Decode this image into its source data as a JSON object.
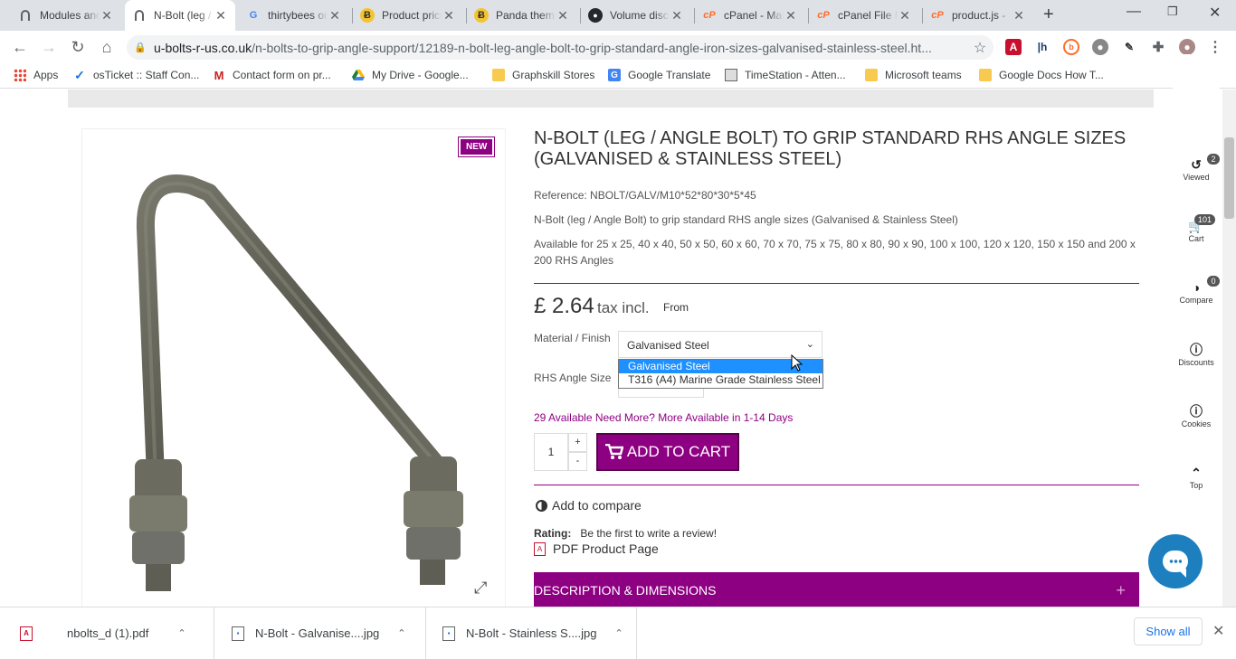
{
  "browser": {
    "tabs": [
      {
        "title": "Modules and Services",
        "favicon": "magnet-icon"
      },
      {
        "title": "N-Bolt (leg / Angle Bolt)",
        "favicon": "magnet-icon",
        "active": true
      },
      {
        "title": "thirtybees on",
        "favicon": "google-icon"
      },
      {
        "title": "Product price",
        "favicon": "bee-icon"
      },
      {
        "title": "Panda theme",
        "favicon": "bee-icon"
      },
      {
        "title": "Volume discounts",
        "favicon": "github-icon"
      },
      {
        "title": "cPanel - Main",
        "favicon": "cpanel-icon"
      },
      {
        "title": "cPanel File Manager",
        "favicon": "cpanel-icon"
      },
      {
        "title": "product.js - ",
        "favicon": "cpanel-icon"
      }
    ],
    "new_tab": "+",
    "url_domain": "u-bolts-r-us.co.uk",
    "url_path": "/n-bolts-to-grip-angle-support/12189-n-bolt-leg-angle-bolt-to-grip-standard-angle-iron-sizes-galvanised-stainless-steel.ht...",
    "bookmarks": [
      {
        "label": "Apps",
        "icon": "apps-grid-icon"
      },
      {
        "label": "osTicket :: Staff Con...",
        "icon": "check-icon"
      },
      {
        "label": "Contact form on pr...",
        "icon": "gmail-icon"
      },
      {
        "label": "My Drive - Google...",
        "icon": "drive-icon"
      },
      {
        "label": "Graphskill Stores",
        "icon": "folder-icon"
      },
      {
        "label": "Google Translate",
        "icon": "translate-icon"
      },
      {
        "label": "TimeStation - Atten...",
        "icon": "timestation-icon"
      },
      {
        "label": "Microsoft teams",
        "icon": "folder-icon"
      },
      {
        "label": "Google Docs How T...",
        "icon": "folder-icon"
      }
    ],
    "bookmarks_more": "»"
  },
  "product": {
    "badge": "NEW",
    "title": "N-Bolt (leg / Angle Bolt) to grip standard RHS angle sizes (Galvanised & Stainless Steel)",
    "reference": "Reference: NBOLT/GALV/M10*52*80*30*5*45",
    "short_desc": "N-Bolt (leg / Angle Bolt) to grip standard RHS angle sizes (Galvanised & Stainless Steel)",
    "available_sizes": "Available for 25 x 25, 40 x 40, 50 x 50, 60 x 60, 70 x 70, 75 x 75, 80 x 80, 90 x 90, 100 x 100, 120 x 120, 150 x 150 and 200 x 200 RHS Angles",
    "price": "£ 2.64",
    "tax_label": "tax incl.",
    "from_label": "From",
    "material_label": "Material / Finish",
    "material_selected": "Galvanised Steel",
    "material_options": [
      "Galvanised Steel",
      "T316 (A4) Marine Grade Stainless Steel"
    ],
    "angle_label": "RHS Angle Size",
    "availability": "29 Available  Need More? More Available in 1-14 Days",
    "quantity": "1",
    "qty_up": "+",
    "qty_down": "-",
    "add_to_cart": "ADD TO CART",
    "add_to_compare": "Add to compare",
    "rating_label": "Rating:",
    "rating_text": "Be the first to write a review!",
    "pdf_label": "PDF Product Page",
    "description_tab": "DESCRIPTION & DIMENSIONS",
    "description_toggle": "+",
    "accent_color": "#8e0082"
  },
  "side_panel": [
    {
      "label": "Viewed",
      "icon": "history-icon",
      "count": "2"
    },
    {
      "label": "Cart",
      "icon": "cart-icon",
      "count": "101"
    },
    {
      "label": "Compare",
      "icon": "compare-icon",
      "count": "0"
    },
    {
      "label": "Discounts",
      "icon": "info-icon"
    },
    {
      "label": "Cookies",
      "icon": "info-icon"
    },
    {
      "label": "Top",
      "icon": "chevron-up-icon"
    }
  ],
  "downloads": [
    {
      "name": "nbolts_d (1).pdf",
      "icon": "pdf-file-icon"
    },
    {
      "name": "N-Bolt - Galvanise....jpg",
      "icon": "image-file-icon"
    },
    {
      "name": "N-Bolt - Stainless S....jpg",
      "icon": "image-file-icon"
    }
  ],
  "show_all": "Show all"
}
